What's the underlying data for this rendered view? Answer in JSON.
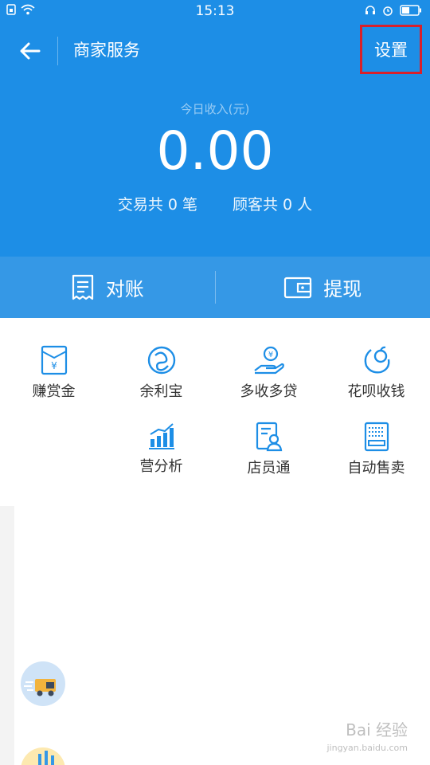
{
  "status_bar": {
    "time": "15:13"
  },
  "header": {
    "title": "商家服务",
    "settings_label": "设置"
  },
  "income": {
    "label": "今日收入(元)",
    "amount": "0.00",
    "transactions_text": "交易共 0 笔",
    "customers_text": "顾客共 0 人"
  },
  "actions": [
    {
      "label": "对账",
      "icon": "receipt-icon"
    },
    {
      "label": "提现",
      "icon": "wallet-icon"
    }
  ],
  "services": [
    {
      "label": "赚赏金",
      "icon": "reward-envelope-icon"
    },
    {
      "label": "余利宝",
      "icon": "yulibao-icon"
    },
    {
      "label": "多收多贷",
      "icon": "loan-hand-icon"
    },
    {
      "label": "花呗收钱",
      "icon": "huabei-icon"
    },
    {
      "label": "营分析",
      "icon": "bar-chart-icon"
    },
    {
      "label": "店员通",
      "icon": "clerk-icon"
    },
    {
      "label": "自动售卖",
      "icon": "vending-machine-icon"
    }
  ],
  "watermark": {
    "text": "Bai 经验",
    "sub": "jingyan.baidu.com"
  },
  "colors": {
    "primary": "#1d8ee6",
    "action_bar": "#3598e6",
    "highlight": "#d8202a",
    "icon_blue": "#1d8ee6"
  }
}
